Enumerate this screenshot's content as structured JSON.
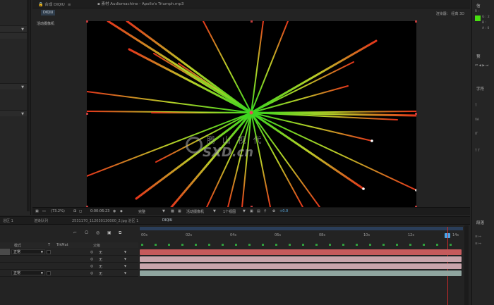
{
  "comp_panel": {
    "tab_label": "合成 DIQIU",
    "footage_tab": "素材 Audiomachine - Apollo's Triumph.mp3",
    "subtab": "DIQIU",
    "camera_label": "活动摄像机",
    "renderer_label": "渲染器：",
    "renderer_value": "经典 3D"
  },
  "comp_toolbar": {
    "zoom": "(73.2%)",
    "timecode": "0:00:06:23",
    "quality": "完整",
    "view": "活动摄像机",
    "views_count": "1个视图",
    "exposure": "+0.0"
  },
  "timeline": {
    "tabs": [
      {
        "label": "浴区 1"
      },
      {
        "label": "渲染队列"
      },
      {
        "label": "2531170_112030130000_2.jpg 浴区 1"
      },
      {
        "label": "DIQIU"
      }
    ],
    "columns": {
      "mode": "模式",
      "t": "T",
      "trkmat": "TrkMat",
      "parent": "父级"
    },
    "ruler_ticks": [
      "00s",
      "02s",
      "04s",
      "06s",
      "08s",
      "10s",
      "12s",
      "14s"
    ],
    "layers": [
      {
        "mode": "正常",
        "parent": "无",
        "bar_color": "#c65a5c"
      },
      {
        "mode": "",
        "parent": "无",
        "bar_color": "#c8a4ab"
      },
      {
        "mode": "",
        "parent": "无",
        "bar_color": "#c8a4ab"
      },
      {
        "mode": "正常",
        "parent": "无",
        "bar_color": "#8fa59f"
      }
    ]
  },
  "right_panel": {
    "info_values": [
      "R :",
      "G : 2",
      "B :",
      "A : 0"
    ],
    "color_swatch": "#47e010",
    "effects_title": "字符",
    "align_title": "段落"
  },
  "watermark": {
    "text": "腾 山 视 代",
    "domain": "SXD.cn"
  }
}
